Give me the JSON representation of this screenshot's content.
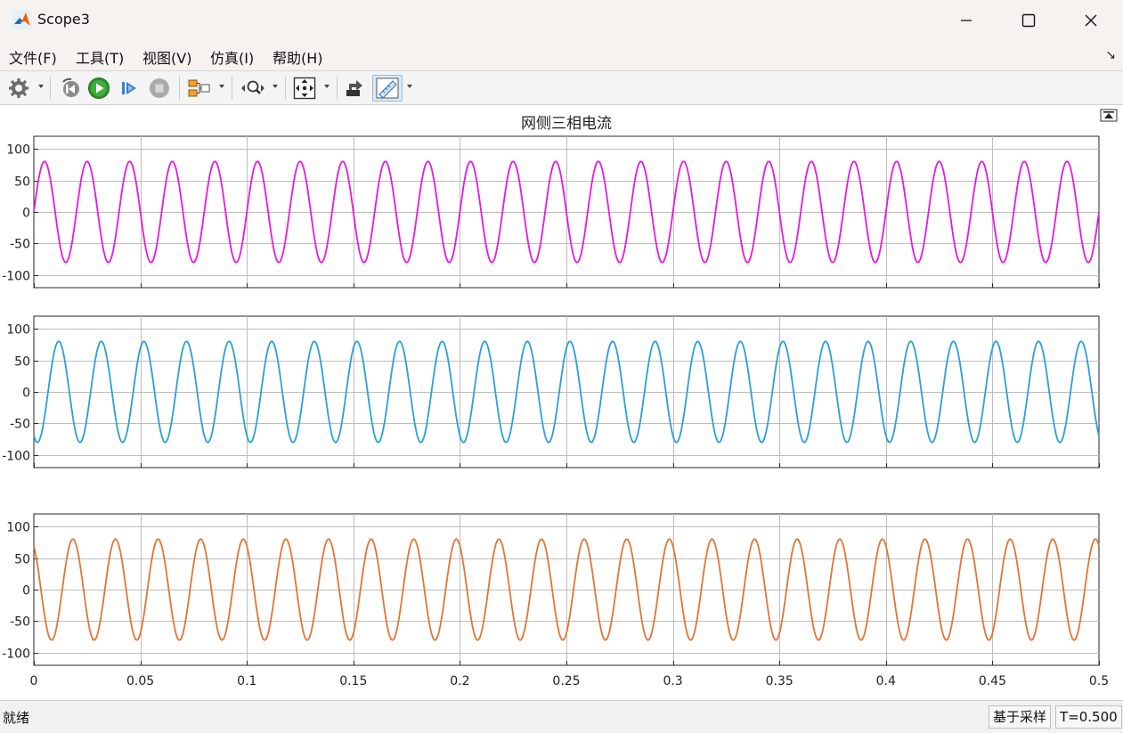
{
  "window": {
    "title": "Scope3",
    "minimize_icon": "minimize-icon",
    "maximize_icon": "maximize-icon",
    "close_icon": "close-icon"
  },
  "menu": {
    "items": [
      {
        "label": "文件(F)"
      },
      {
        "label": "工具(T)"
      },
      {
        "label": "视图(V)"
      },
      {
        "label": "仿真(I)"
      },
      {
        "label": "帮助(H)"
      }
    ],
    "corner_icon": "expand-toolbar-icon"
  },
  "toolbar": {
    "icons": [
      "gear-icon",
      "step-back-icon",
      "run-icon",
      "step-forward-icon",
      "stop-icon",
      "signal-selector-icon",
      "zoom-icon",
      "autoscale-icon",
      "style-icon",
      "measurements-icon"
    ]
  },
  "status": {
    "ready": "就绪",
    "mode": "基于采样",
    "time": "T=0.500"
  },
  "colors": {
    "phase_a": "#e619e0",
    "phase_b": "#2a9fd8",
    "phase_c": "#e07537",
    "grid": "#bdbdbd",
    "axes": "#262626"
  },
  "chart_data": {
    "type": "line",
    "title": "网侧三相电流",
    "x_range": [
      0,
      0.5
    ],
    "xticks": [
      "0",
      "0.05",
      "0.1",
      "0.15",
      "0.2",
      "0.25",
      "0.3",
      "0.35",
      "0.4",
      "0.45",
      "0.5"
    ],
    "frequency_hz": 50,
    "grid": true,
    "legend": false,
    "panels": [
      {
        "ylim": [
          -120,
          120
        ],
        "yticks": [
          "100",
          "50",
          "0",
          "-50",
          "-100"
        ],
        "amplitude": 80,
        "phase_deg": 0,
        "color": "#e619e0"
      },
      {
        "ylim": [
          -120,
          120
        ],
        "yticks": [
          "100",
          "50",
          "0",
          "-50",
          "-100"
        ],
        "amplitude": 80,
        "phase_deg": -120,
        "color": "#2a9fd8"
      },
      {
        "ylim": [
          -120,
          120
        ],
        "yticks": [
          "100",
          "50",
          "0",
          "-50",
          "-100"
        ],
        "amplitude": 80,
        "phase_deg": 120,
        "color": "#e07537"
      }
    ]
  }
}
